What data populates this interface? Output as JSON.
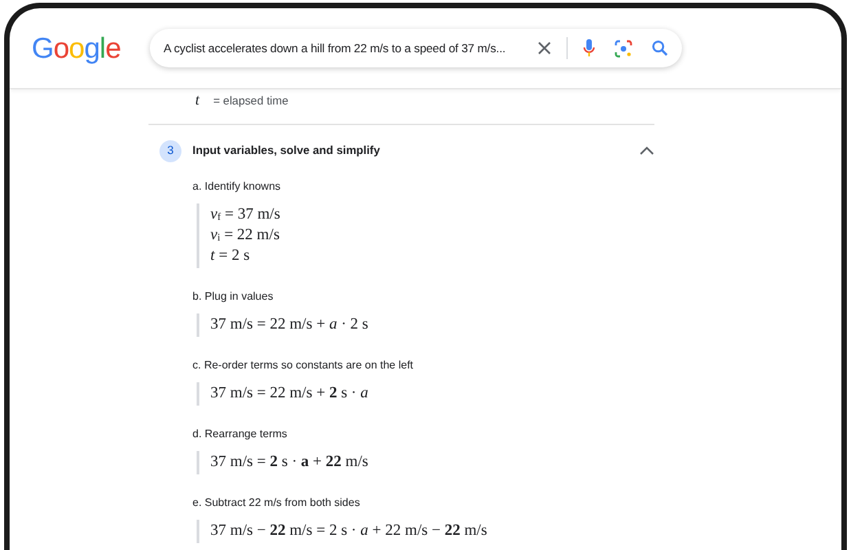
{
  "header": {
    "logo": "Google",
    "search": {
      "value": "A cyclist accelerates down a hill from 22 m/s to a speed of 37 m/s..."
    }
  },
  "variable_row": {
    "symbol": "t",
    "definition": "= elapsed time"
  },
  "step": {
    "number": "3",
    "title": "Input variables, solve and simplify",
    "expanded": true,
    "substeps": [
      {
        "label": "a. Identify knowns",
        "equations": [
          "*v*$_{f}$ = 37 m/s",
          "*v*$_{i}$ = 22 m/s",
          "*t* = 2 s"
        ]
      },
      {
        "label": "b. Plug in values",
        "equations": [
          "37 m/s = 22 m/s + *a* · 2 s"
        ]
      },
      {
        "label": "c. Re-order terms so constants are on the left",
        "equations": [
          "37 m/s = 22 m/s + **2** s · *a*"
        ]
      },
      {
        "label": "d. Rearrange terms",
        "equations": [
          "37 m/s = **2** s · **a** + **22** m/s"
        ]
      },
      {
        "label": "e. Subtract 22 m/s from both sides",
        "equations": [
          "37 m/s − **22** m/s = 2 s · *a* + 22 m/s − **22** m/s"
        ]
      }
    ]
  }
}
